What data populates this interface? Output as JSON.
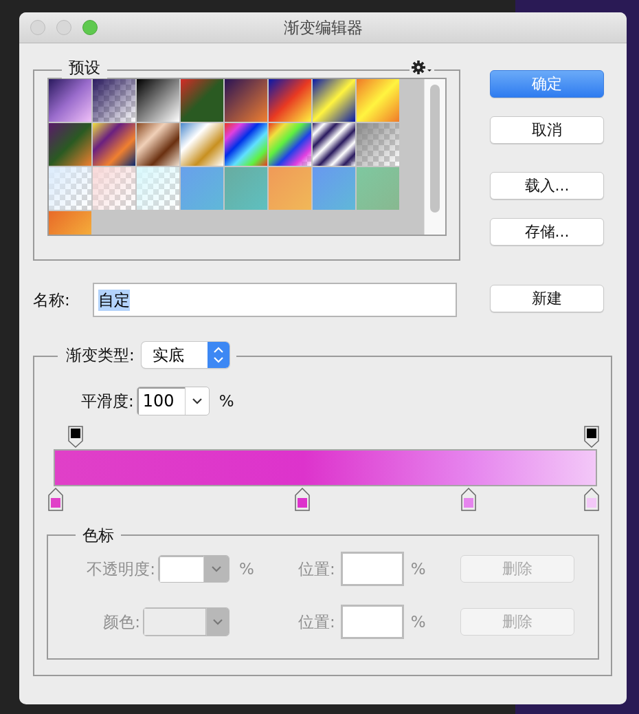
{
  "window": {
    "title": "渐变编辑器",
    "buttons": [
      {
        "kind": "close",
        "enabled": false
      },
      {
        "kind": "minimize",
        "enabled": false
      },
      {
        "kind": "zoom",
        "enabled": true
      }
    ]
  },
  "presets": {
    "title": "预设"
  },
  "actions": [
    "确定",
    "取消",
    "载入...",
    "存储...",
    "新建"
  ],
  "name": {
    "label": "名称:",
    "value": "自定",
    "selected": true
  },
  "gradient": {
    "type_label": "渐变类型:",
    "type_value": "实底",
    "smoothness_label": "平滑度:",
    "smoothness_value": "100",
    "smoothness_unit": "%",
    "opacity_stops": [
      {
        "color": "#000000"
      },
      {
        "color": "#000000"
      }
    ],
    "color_stops": [
      {
        "color": "#e040c8"
      },
      {
        "color": "#dd33cc"
      },
      {
        "color": "#e685ee"
      },
      {
        "color": "#f3c8f8"
      }
    ]
  },
  "stops": {
    "title": "色标",
    "disabled": true,
    "rows": [
      {
        "kind": "opacity",
        "label": "不透明度:",
        "unit": "%",
        "position_label": "位置:",
        "position_unit": "%",
        "button": "删除"
      },
      {
        "kind": "color",
        "label": "颜色:",
        "position_label": "位置:",
        "position_unit": "%",
        "button": "删除"
      }
    ]
  }
}
